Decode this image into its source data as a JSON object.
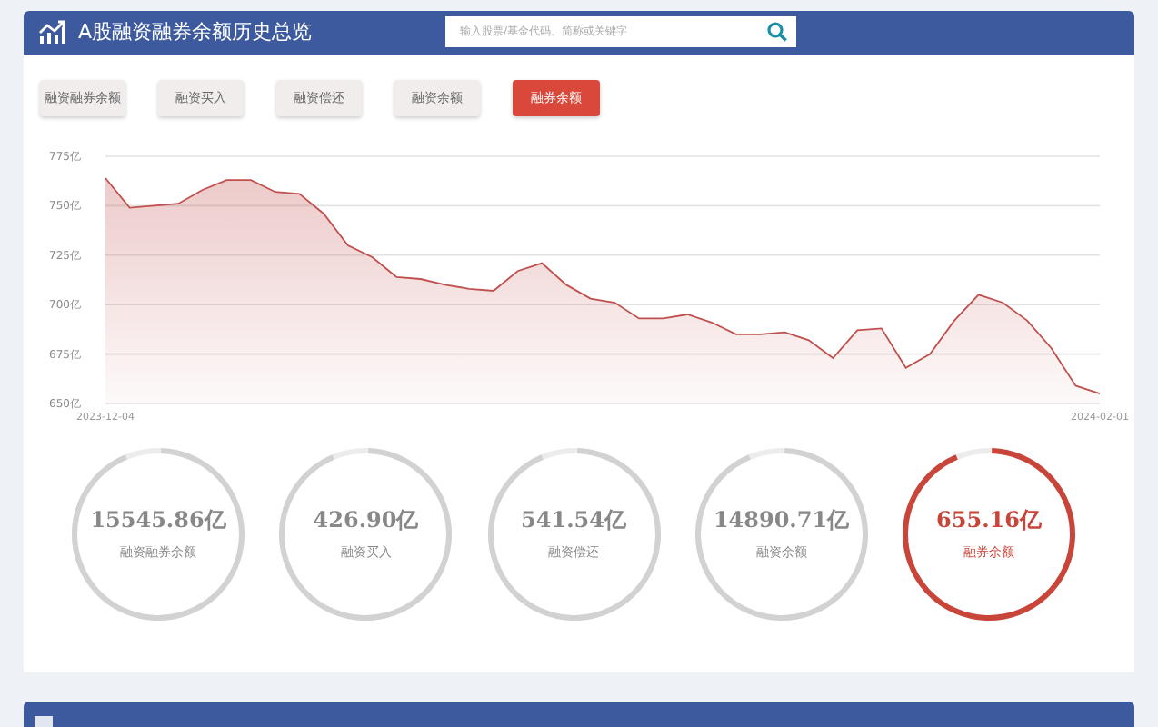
{
  "header": {
    "title": "A股融资融券余额历史总览",
    "search": {
      "placeholder": "输入股票/基金代码、简称或关键字"
    }
  },
  "tabs": [
    {
      "label": "融资融券余额",
      "selected": false
    },
    {
      "label": "融资买入",
      "selected": false
    },
    {
      "label": "融资偿还",
      "selected": false
    },
    {
      "label": "融资余额",
      "selected": false
    },
    {
      "label": "融券余额",
      "selected": true
    }
  ],
  "chart": {
    "chart_data": {
      "type": "area",
      "ylim": [
        650,
        775
      ],
      "yticks": [
        {
          "value": 775,
          "label": "775亿"
        },
        {
          "value": 750,
          "label": "750亿"
        },
        {
          "value": 725,
          "label": "725亿"
        },
        {
          "value": 700,
          "label": "700亿"
        },
        {
          "value": 675,
          "label": "675亿"
        },
        {
          "value": 650,
          "label": "650亿"
        }
      ],
      "grid": true,
      "categories": [
        "2023-12-04",
        null,
        null,
        null,
        null,
        null,
        null,
        null,
        null,
        null,
        null,
        null,
        null,
        null,
        null,
        null,
        null,
        null,
        null,
        null,
        null,
        null,
        null,
        null,
        null,
        null,
        null,
        null,
        null,
        null,
        null,
        null,
        null,
        null,
        null,
        null,
        null,
        null,
        null,
        null,
        null,
        "2024-02-01"
      ],
      "series": [
        {
          "color": "#c0504d",
          "values": [
            764,
            749,
            750,
            751,
            758,
            763,
            763,
            757,
            756,
            746,
            730,
            724,
            714,
            713,
            710,
            708,
            707,
            717,
            721,
            710,
            703,
            701,
            693,
            693,
            695,
            691,
            685,
            685,
            686,
            682,
            673,
            687,
            688,
            668,
            675,
            692,
            705,
            701,
            692,
            678,
            659,
            655
          ]
        }
      ]
    }
  },
  "summary": [
    {
      "value": "15545.86亿",
      "label": "融资融券余额",
      "selected": false
    },
    {
      "value": "426.90亿",
      "label": "融资买入",
      "selected": false
    },
    {
      "value": "541.54亿",
      "label": "融资偿还",
      "selected": false
    },
    {
      "value": "14890.71亿",
      "label": "融资余额",
      "selected": false
    },
    {
      "value": "655.16亿",
      "label": "融券余额",
      "selected": true
    }
  ]
}
